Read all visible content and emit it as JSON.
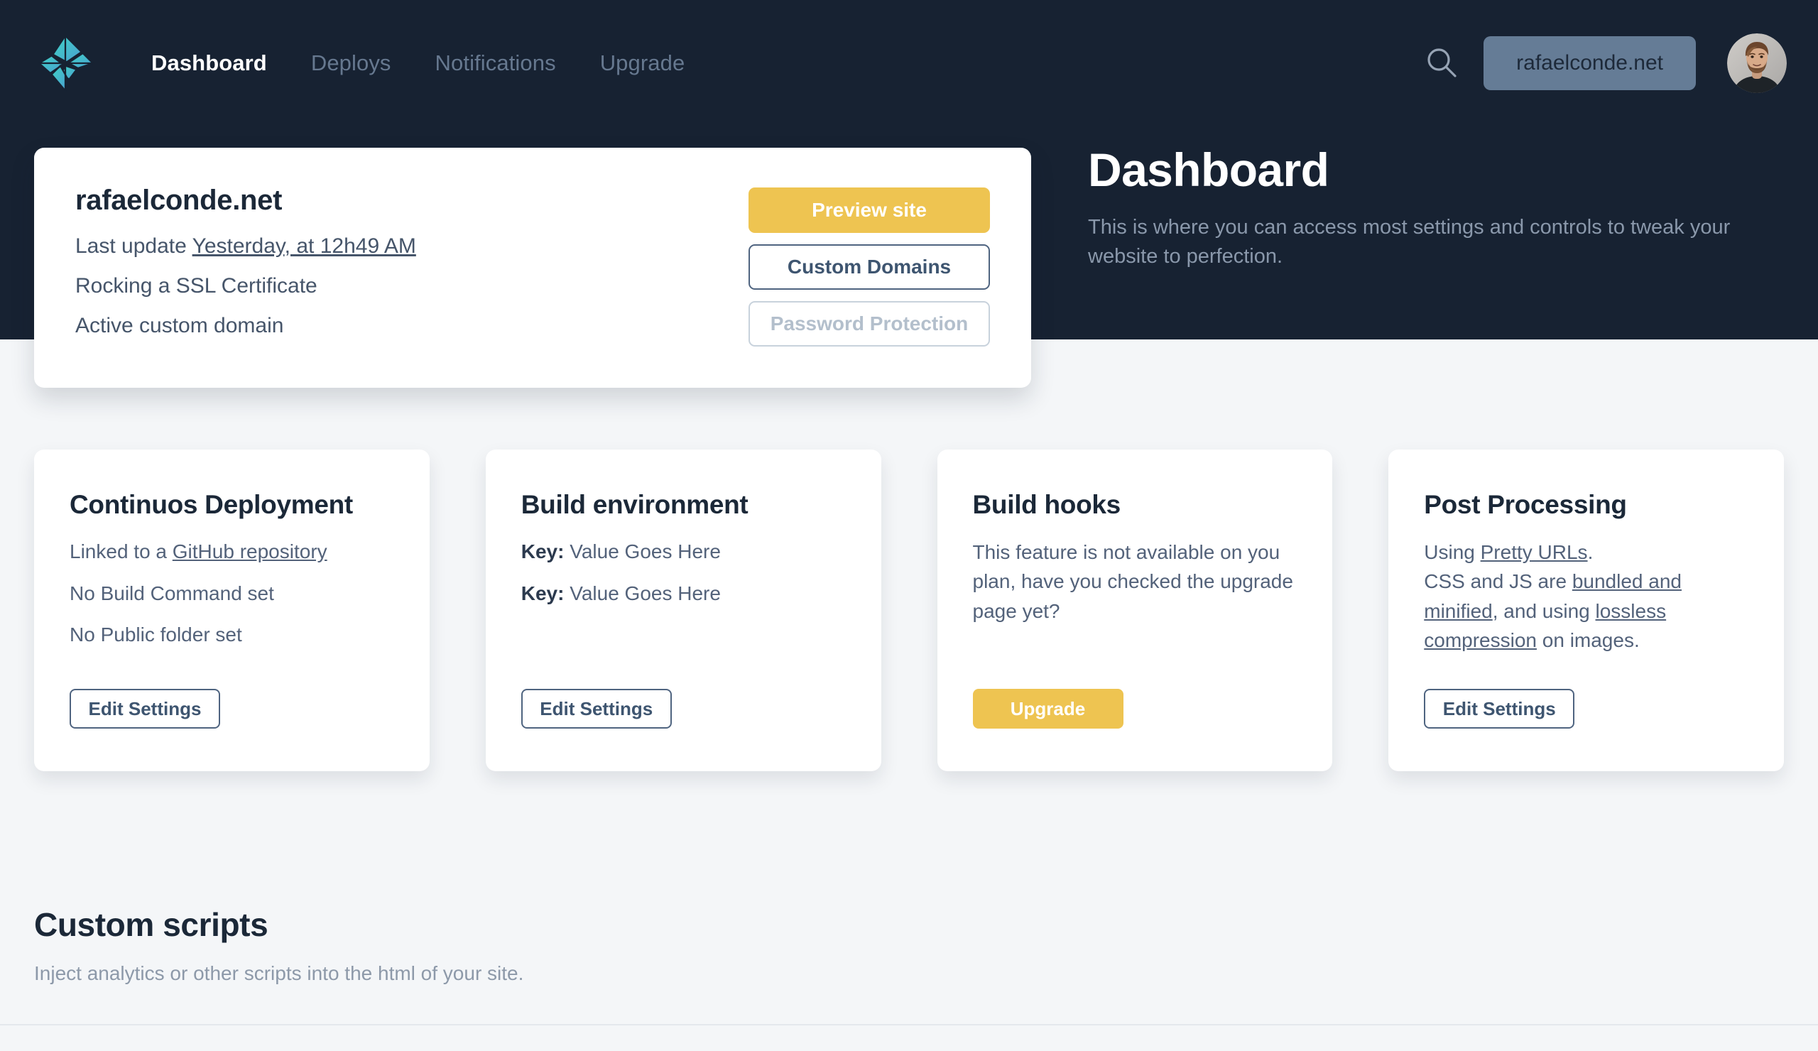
{
  "nav": {
    "logo_icon": "netlify-diamond-logo",
    "links": [
      {
        "label": "Dashboard",
        "active": true
      },
      {
        "label": "Deploys",
        "active": false
      },
      {
        "label": "Notifications",
        "active": false
      },
      {
        "label": "Upgrade",
        "active": false
      }
    ],
    "search_icon": "search-icon",
    "site_pill": "rafaelconde.net",
    "avatar_alt": "user-avatar"
  },
  "hero": {
    "title": "Dashboard",
    "subtitle": "This is where you can access most settings and controls to tweak your website to perfection."
  },
  "site_card": {
    "title": "rafaelconde.net",
    "last_update_prefix": "Last update ",
    "last_update_link": "Yesterday, at 12h49 AM",
    "ssl_line": "Rocking a SSL Certificate",
    "domain_line": "Active custom domain",
    "buttons": {
      "preview": "Preview site",
      "custom_domains": "Custom Domains",
      "password_protection": "Password Protection"
    }
  },
  "cards": [
    {
      "title": "Continuos Deployment",
      "line1_prefix": "Linked to a ",
      "line1_link": "GitHub repository",
      "line2": "No Build Command set",
      "line3": "No Public folder set",
      "button": "Edit Settings",
      "button_style": "outline"
    },
    {
      "title": "Build environment",
      "key1": "Key:",
      "value1": " Value Goes Here",
      "key2": "Key:",
      "value2": " Value Goes Here",
      "button": "Edit Settings",
      "button_style": "outline"
    },
    {
      "title": "Build hooks",
      "paragraph": "This feature is not available on you plan, have you checked the upgrade page yet?",
      "button": "Upgrade",
      "button_style": "primary"
    },
    {
      "title": "Post Processing",
      "p1_prefix": "Using ",
      "p1_link": "Pretty URLs",
      "p1_suffix": ".",
      "p2_prefix": "CSS and JS are ",
      "p2_link1": "bundled and minified",
      "p2_mid": ", and using ",
      "p2_link2": "lossless compression",
      "p2_suffix": " on images.",
      "button": "Edit Settings",
      "button_style": "outline"
    }
  ],
  "scripts_section": {
    "title": "Custom scripts",
    "subtitle": "Inject analytics or other scripts into the html of your site."
  },
  "colors": {
    "header_bg": "#172232",
    "page_bg": "#f4f6f8",
    "accent_yellow": "#eec451",
    "outline_blue": "#4f6480",
    "pill_bg": "#657c96",
    "logo_teal_light": "#3ecfc0",
    "logo_teal_dark": "#4ba5c9"
  }
}
